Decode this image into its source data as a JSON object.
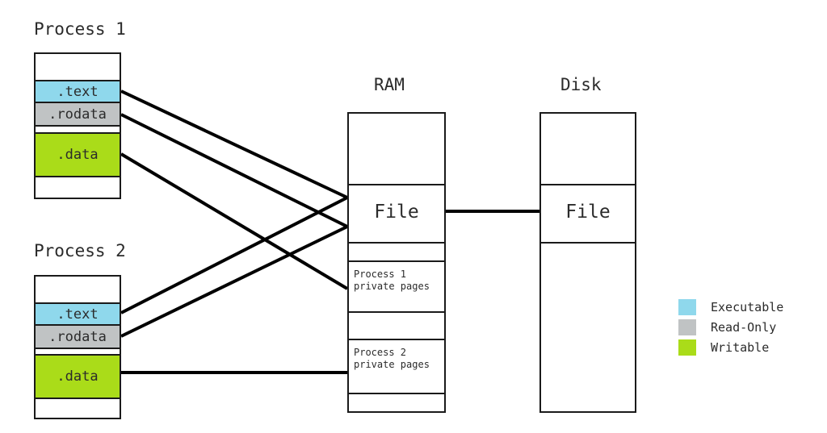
{
  "diagram": {
    "title_process1": "Process 1",
    "title_process2": "Process 2",
    "title_ram": "RAM",
    "title_disk": "Disk"
  },
  "colors": {
    "executable": "#8fd8ec",
    "readonly": "#c0c3c4",
    "writable": "#aadc19",
    "outline": "#1a1a1a",
    "background": "#ffffff",
    "text": "#2b2b2b"
  },
  "process1": {
    "label": "Process 1",
    "segments": [
      {
        "name": "unmapped-top",
        "label": "",
        "fill": "none"
      },
      {
        "name": "text",
        "label": ".text",
        "fill": "executable"
      },
      {
        "name": "rodata",
        "label": ".rodata",
        "fill": "readonly"
      },
      {
        "name": "data",
        "label": ".data",
        "fill": "writable"
      },
      {
        "name": "unmapped-bottom",
        "label": "",
        "fill": "none"
      }
    ]
  },
  "process2": {
    "label": "Process 2",
    "segments": [
      {
        "name": "unmapped-top",
        "label": "",
        "fill": "none"
      },
      {
        "name": "text",
        "label": ".text",
        "fill": "executable"
      },
      {
        "name": "rodata",
        "label": ".rodata",
        "fill": "readonly"
      },
      {
        "name": "data",
        "label": ".data",
        "fill": "writable"
      },
      {
        "name": "unmapped-bottom",
        "label": "",
        "fill": "none"
      }
    ]
  },
  "ram": {
    "label": "RAM",
    "segments": [
      {
        "name": "free-1",
        "label": ""
      },
      {
        "name": "file",
        "label": "File"
      },
      {
        "name": "free-2",
        "label": ""
      },
      {
        "name": "proc1-private",
        "label": "Process 1\nprivate pages"
      },
      {
        "name": "free-3",
        "label": ""
      },
      {
        "name": "proc2-private",
        "label": "Process 2\nprivate pages"
      },
      {
        "name": "free-4",
        "label": ""
      }
    ]
  },
  "disk": {
    "label": "Disk",
    "segments": [
      {
        "name": "free-1",
        "label": ""
      },
      {
        "name": "file",
        "label": "File"
      },
      {
        "name": "free-2",
        "label": ""
      }
    ]
  },
  "legend": {
    "items": [
      {
        "name": "executable",
        "label": "Executable",
        "color": "#8fd8ec"
      },
      {
        "name": "readonly",
        "label": "Read-Only",
        "color": "#c0c3c4"
      },
      {
        "name": "writable",
        "label": "Writable",
        "color": "#aadc19"
      }
    ]
  },
  "connections": [
    {
      "name": "p1-text-to-ram-file",
      "from": "process1.text",
      "to": "ram.file"
    },
    {
      "name": "p1-rodata-to-ram-file",
      "from": "process1.rodata",
      "to": "ram.file"
    },
    {
      "name": "p1-data-to-p1-private",
      "from": "process1.data",
      "to": "ram.proc1-private"
    },
    {
      "name": "p2-text-to-ram-file",
      "from": "process2.text",
      "to": "ram.file"
    },
    {
      "name": "p2-rodata-to-ram-file",
      "from": "process2.rodata",
      "to": "ram.file"
    },
    {
      "name": "p2-data-to-p2-private",
      "from": "process2.data",
      "to": "ram.proc2-private"
    },
    {
      "name": "ram-file-to-disk-file",
      "from": "ram.file",
      "to": "disk.file"
    }
  ]
}
